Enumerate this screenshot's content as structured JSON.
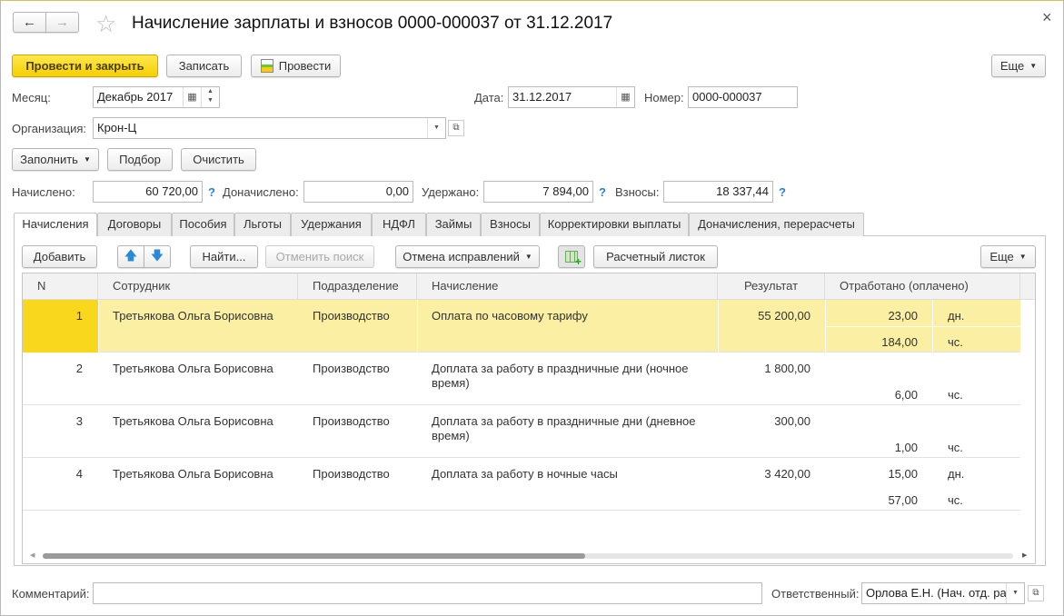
{
  "window": {
    "title": "Начисление зарплаты и взносов 0000-000037 от 31.12.2017",
    "close": "×",
    "back": "←",
    "forward": "→",
    "star": "☆"
  },
  "toolbar": {
    "post_close": "Провести и закрыть",
    "save": "Записать",
    "post": "Провести",
    "more": "Еще"
  },
  "header": {
    "month_label": "Месяц:",
    "month_value": "Декабрь 2017",
    "date_label": "Дата:",
    "date_value": "31.12.2017",
    "number_label": "Номер:",
    "number_value": "0000-000037",
    "org_label": "Организация:",
    "org_value": "Крон-Ц"
  },
  "fill_buttons": {
    "fill": "Заполнить",
    "select": "Подбор",
    "clear": "Очистить"
  },
  "totals": {
    "accrued_label": "Начислено:",
    "accrued": "60 720,00",
    "additional_label": "Доначислено:",
    "additional": "0,00",
    "withheld_label": "Удержано:",
    "withheld": "7 894,00",
    "contrib_label": "Взносы:",
    "contrib": "18 337,44",
    "help": "?"
  },
  "tabs": [
    "Начисления",
    "Договоры",
    "Пособия",
    "Льготы",
    "Удержания",
    "НДФЛ",
    "Займы",
    "Взносы",
    "Корректировки выплаты",
    "Доначисления, перерасчеты"
  ],
  "table_toolbar": {
    "add": "Добавить",
    "find": "Найти...",
    "cancel_search": "Отменить поиск",
    "undo_fixes": "Отмена исправлений",
    "payslip": "Расчетный листок",
    "more": "Еще"
  },
  "table": {
    "columns": [
      "N",
      "Сотрудник",
      "Подразделение",
      "Начисление",
      "Результат",
      "Отработано (оплачено)"
    ],
    "rows": [
      {
        "n": "1",
        "employee": "Третьякова Ольга Борисовна",
        "dept": "Производство",
        "accrual": "Оплата по часовому тарифу",
        "result": "55 200,00",
        "days": "23,00",
        "days_unit": "дн.",
        "hours": "184,00",
        "hours_unit": "чс."
      },
      {
        "n": "2",
        "employee": "Третьякова Ольга Борисовна",
        "dept": "Производство",
        "accrual": "Доплата за работу в праздничные дни (ночное время)",
        "result": "1 800,00",
        "days": "",
        "days_unit": "",
        "hours": "6,00",
        "hours_unit": "чс."
      },
      {
        "n": "3",
        "employee": "Третьякова Ольга Борисовна",
        "dept": "Производство",
        "accrual": "Доплата за работу в праздничные дни (дневное время)",
        "result": "300,00",
        "days": "",
        "days_unit": "",
        "hours": "1,00",
        "hours_unit": "чс."
      },
      {
        "n": "4",
        "employee": "Третьякова Ольга Борисовна",
        "dept": "Производство",
        "accrual": "Доплата за работу в ночные часы",
        "result": "3 420,00",
        "days": "15,00",
        "days_unit": "дн.",
        "hours": "57,00",
        "hours_unit": "чс."
      }
    ],
    "selected_row": 1
  },
  "footer": {
    "comment_label": "Комментарий:",
    "comment_value": "",
    "responsible_label": "Ответственный:",
    "responsible_value": "Орлова Е.Н. (Нач. отд. ра"
  },
  "colors": {
    "accent": "#f5cf00",
    "selected_row": "#fbefa3",
    "selected_cell": "#f9d71c",
    "help": "#2a7fd4"
  }
}
